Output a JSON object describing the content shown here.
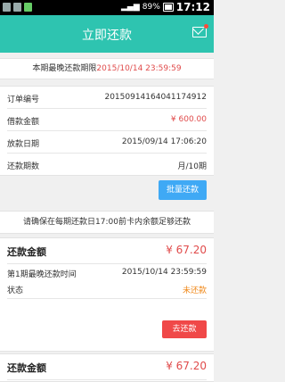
{
  "status_bar": {
    "battery": "89%",
    "time": "17:12"
  },
  "header": {
    "title": "立即还款"
  },
  "deadline": {
    "label": "本期最晚还款期限",
    "datetime": "2015/10/14 23:59:59"
  },
  "order": {
    "rows": [
      {
        "label": "订单编号",
        "value": "2015091416404117491​2"
      },
      {
        "label": "借款金额",
        "value": "¥ 600.00"
      },
      {
        "label": "放款日期",
        "value": "2015/09/14 17:06:20"
      },
      {
        "label": "还款期数",
        "value": "月/10期"
      }
    ]
  },
  "batch_button": "批量还款",
  "note": "请确保在每期还款日17:00前卡内余额足够还款",
  "cards": [
    {
      "title": "还款金额",
      "amount": "¥ 67.20",
      "line1_label": "第1期最晚还款时间",
      "line1_value": "2015/10/14 23:59:59",
      "status_label": "状态",
      "status_value": "未还款",
      "button": "去还款"
    },
    {
      "title": "还款金额",
      "amount": "¥ 67.20"
    }
  ],
  "colors": {
    "header": "#2ec4b0",
    "red": "#e04b4b",
    "blue_button": "#3fa9f5",
    "pay_button": "#f04848",
    "status_orange": "#f08a1c"
  }
}
